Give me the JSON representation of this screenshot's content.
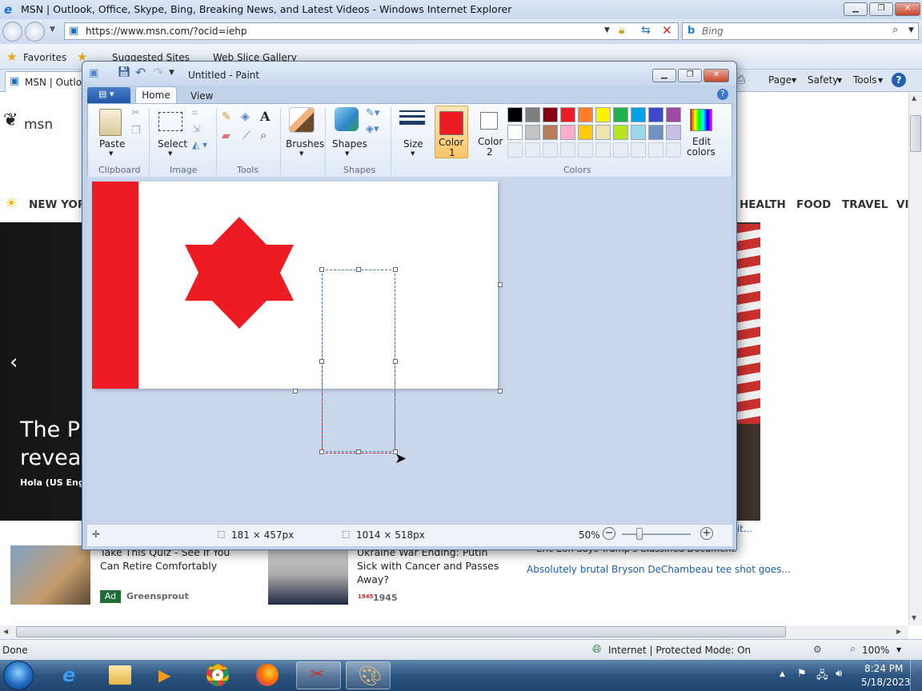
{
  "ie": {
    "title": "MSN | Outlook, Office, Skype, Bing, Breaking News, and Latest Videos - Windows Internet Explorer",
    "url": "https://www.msn.com/?ocid=iehp",
    "search_placeholder": "Bing",
    "favorites": "Favorites",
    "suggested_sites": "Suggested Sites",
    "web_slice_gallery": "Web Slice Gallery",
    "tab_label": "MSN | Outlo",
    "menu": {
      "page": "Page",
      "safety": "Safety",
      "tools": "Tools"
    },
    "status_left": "Done",
    "status_zone": "Internet | Protected Mode: On",
    "zoom": "100%"
  },
  "msn": {
    "logo": "msn",
    "nav": [
      "NEW YORK",
      "HEALTH",
      "FOOD",
      "TRAVEL",
      "VI"
    ],
    "hero_title_line1": "The Pr",
    "hero_title_line2": "reveal",
    "hero_source": "Hola (US Englis",
    "cards": [
      {
        "title": "Take This Quiz - See If You Can Retire Comfortably",
        "badge": "Ad",
        "source": "Greensprout"
      },
      {
        "title": "Ukraine War Ending: Putin Sick with Cancer and Passes Away?",
        "source": "1945"
      }
    ],
    "side_headline_partial": "Eric Eon Says Trump's Classified Documents Scan",
    "side_link": "Absolutely brutal Bryson DeChambeau tee shot goes...",
    "side_link_partial": "it..."
  },
  "paint": {
    "title": "Untitled - Paint",
    "tabs": {
      "home": "Home",
      "view": "View"
    },
    "groups": {
      "clipboard": "Clipboard",
      "image": "Image",
      "tools": "Tools",
      "shapes": "Shapes",
      "colors": "Colors"
    },
    "buttons": {
      "paste": "Paste",
      "select": "Select",
      "brushes": "Brushes",
      "shapes": "Shapes",
      "size": "Size",
      "color1_line1": "Color",
      "color1_line2": "1",
      "color2_line1": "Color",
      "color2_line2": "2",
      "edit_colors_line1": "Edit",
      "edit_colors_line2": "colors"
    },
    "color1": "#ed1c24",
    "color2": "#ffffff",
    "palette_row1": [
      "#000000",
      "#7f7f7f",
      "#880015",
      "#ed1c24",
      "#ff7f27",
      "#fff200",
      "#22b14c",
      "#00a2e8",
      "#3f48cc",
      "#a349a4"
    ],
    "palette_row2": [
      "#ffffff",
      "#c3c3c3",
      "#b97a57",
      "#ffaec9",
      "#ffc90e",
      "#efe4b0",
      "#b5e61d",
      "#99d9ea",
      "#7092be",
      "#c8bfe7"
    ],
    "status": {
      "selection": "181 × 457px",
      "canvas_size": "1014 × 518px",
      "zoom": "50%"
    }
  },
  "taskbar": {
    "time": "8:24 PM",
    "date": "5/18/2023"
  }
}
